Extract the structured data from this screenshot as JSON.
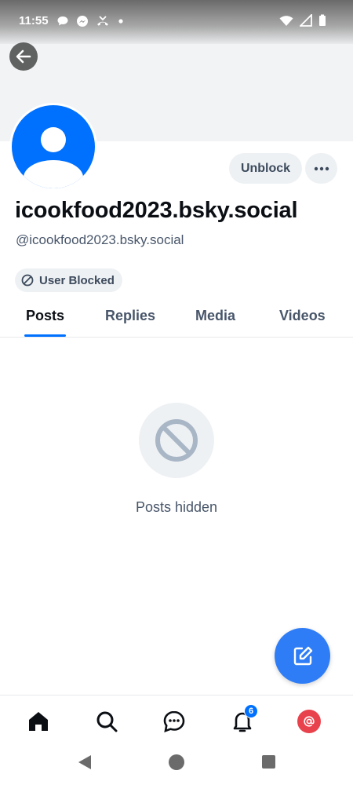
{
  "status_bar": {
    "time": "11:55",
    "left_icons": [
      "chat-bubble-icon",
      "messenger-icon",
      "missed-call-icon",
      "dot-icon"
    ],
    "right_icons": [
      "wifi-icon",
      "signal-icon",
      "battery-icon"
    ]
  },
  "profile": {
    "display_name": "icookfood2023.bsky.social",
    "handle": "@icookfood2023.bsky.social",
    "unblock_label": "Unblock",
    "blocked_badge": "User Blocked"
  },
  "tabs": [
    {
      "label": "Posts",
      "active": true
    },
    {
      "label": "Replies",
      "active": false
    },
    {
      "label": "Media",
      "active": false
    },
    {
      "label": "Videos",
      "active": false
    }
  ],
  "empty_state": {
    "message": "Posts hidden"
  },
  "bottom_nav": {
    "items": [
      "home-icon",
      "search-icon",
      "chat-icon",
      "bell-icon",
      "profile-avatar"
    ],
    "notification_count": "6"
  },
  "colors": {
    "accent": "#0070ff",
    "fab": "#2f7df6",
    "me_avatar": "#e8434d"
  }
}
